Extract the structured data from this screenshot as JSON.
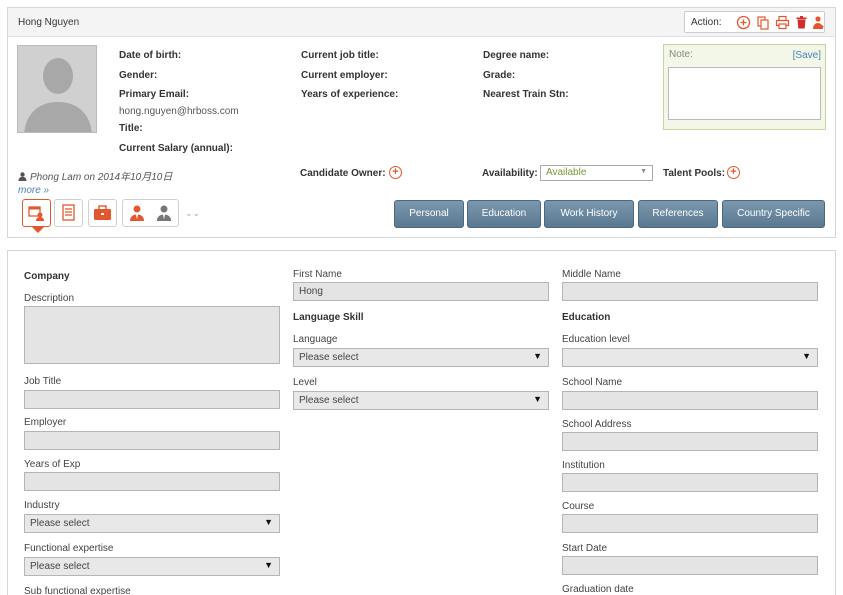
{
  "header": {
    "candidate_name": "Hong Nguyen",
    "action_label": "Action:",
    "action_icons": [
      "add-icon",
      "copy-icon",
      "print-icon",
      "delete-icon",
      "assign-icon"
    ]
  },
  "profile": {
    "col1": {
      "dob_label": "Date of birth:",
      "gender_label": "Gender:",
      "email_label": "Primary Email:",
      "email_value": "hong.nguyen@hrboss.com",
      "title_label": "Title:",
      "salary_label": "Current Salary (annual):"
    },
    "col2": {
      "job_title_label": "Current job title:",
      "employer_label": "Current employer:",
      "experience_label": "Years of experience:"
    },
    "col3": {
      "degree_label": "Degree name:",
      "grade_label": "Grade:",
      "train_label": "Nearest Train Stn:"
    },
    "note": {
      "label": "Note:",
      "save": "[Save]"
    },
    "created_by": "Phong Lam on 2014年10月10日",
    "more_link": "more »",
    "owner_label": "Candidate Owner:",
    "availability_label": "Availability:",
    "availability_value": "Available",
    "talent_pools_label": "Talent Pools:"
  },
  "tabs": [
    "Personal",
    "Education",
    "Work History",
    "References",
    "Country Specific"
  ],
  "colors": {
    "accent": "#e4572e",
    "tab": "#6a879d",
    "link": "#4a7fb5"
  },
  "form": {
    "col1": {
      "company_heading": "Company",
      "description_label": "Description",
      "job_title_label": "Job Title",
      "employer_label": "Employer",
      "years_exp_label": "Years of Exp",
      "industry_label": "Industry",
      "industry_value": "Please select",
      "functional_label": "Functional expertise",
      "functional_value": "Please select",
      "sub_functional_label": "Sub functional expertise"
    },
    "col2": {
      "first_name_label": "First Name",
      "first_name_value": "Hong",
      "language_skill_heading": "Language Skill",
      "language_label": "Language",
      "language_value": "Please select",
      "level_label": "Level",
      "level_value": "Please select"
    },
    "col3": {
      "middle_name_label": "Middle Name",
      "education_heading": "Education",
      "education_level_label": "Education level",
      "school_name_label": "School Name",
      "school_address_label": "School Address",
      "institution_label": "Institution",
      "course_label": "Course",
      "start_date_label": "Start Date",
      "graduation_label": "Graduation date"
    }
  }
}
